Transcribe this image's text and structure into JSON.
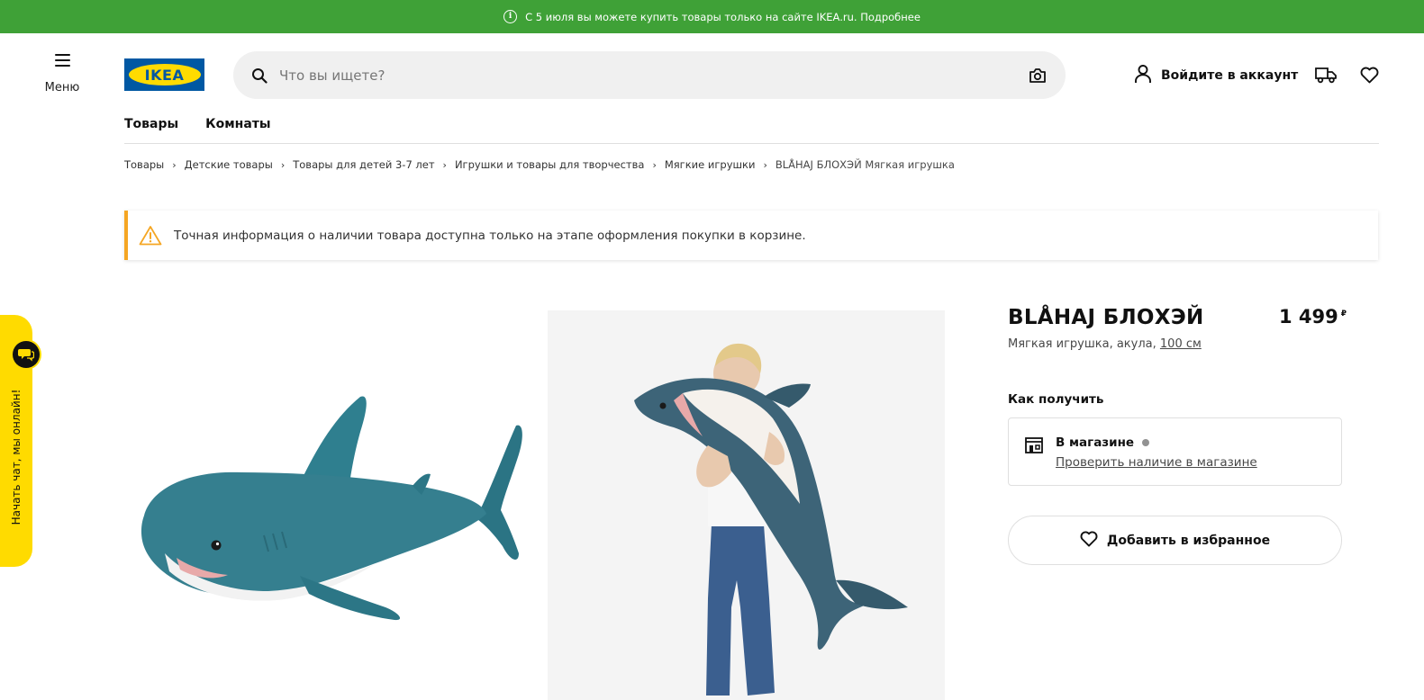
{
  "banner": {
    "text": "С 5 июля вы можете купить товары только на сайте IKEA.ru. Подробнее",
    "icon": "info-circle-icon",
    "color": "#3fa137"
  },
  "header": {
    "menu_label": "Меню",
    "logo_text": "IKEA",
    "search_placeholder": "Что вы ищете?",
    "account_label": "Войдите в аккаунт",
    "icons": [
      "menu-icon",
      "search-icon",
      "camera-icon",
      "user-icon",
      "truck-icon",
      "heart-icon"
    ]
  },
  "nav": {
    "items": [
      "Товары",
      "Комнаты"
    ]
  },
  "breadcrumb": {
    "items": [
      "Товары",
      "Детские товары",
      "Товары для детей 3-7 лет",
      "Игрушки и товары для творчества",
      "Мягкие игрушки"
    ],
    "current": "BLÅHAJ БЛОХЭЙ Мягкая игрушка"
  },
  "notice": {
    "text": "Точная информация о наличии товара доступна только на этапе оформления покупки в корзине.",
    "accent": "#f5a623"
  },
  "chat": {
    "label": "Начать чат, мы онлайн!",
    "color": "#ffdb00"
  },
  "product": {
    "name": "BLÅHAJ БЛОХЭЙ",
    "price": "1 499",
    "currency": "₽",
    "desc_prefix": "Мягкая игрушка, акула, ",
    "size": "100 см",
    "how_to_get": "Как получить",
    "store_title": "В магазине",
    "store_link": "Проверить наличие в магазине",
    "fav_button": "Добавить в избранное"
  }
}
